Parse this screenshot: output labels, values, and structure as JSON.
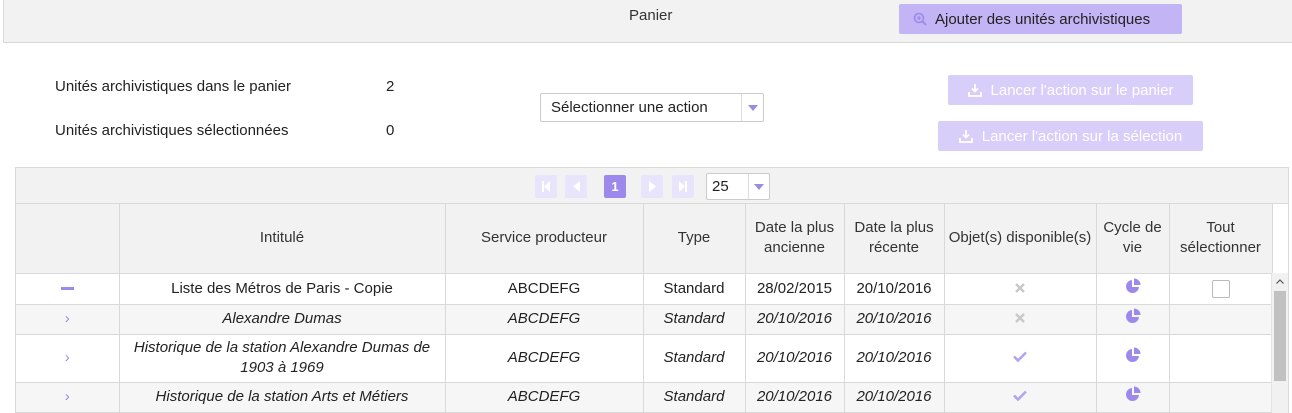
{
  "header": {
    "title": "Panier",
    "add_button": "Ajouter des unités archivistiques",
    "add_icon": "search-plus-icon"
  },
  "stats": {
    "in_cart_label": "Unités archivistiques dans le panier",
    "in_cart_value": "2",
    "selected_label": "Unités archivistiques sélectionnées",
    "selected_value": "0"
  },
  "action_select": {
    "value": "Sélectionner une action"
  },
  "buttons": {
    "run_cart": "Lancer l'action sur le panier",
    "run_selection": "Lancer l'action sur la sélection"
  },
  "pager": {
    "current_page": "1",
    "page_size": "25"
  },
  "colors": {
    "accent": "#9d89ec",
    "button_bg": "#c3b4f5",
    "button_disabled": "#d7cffa"
  },
  "table": {
    "headers": {
      "title": "Intitulé",
      "producer": "Service producteur",
      "type": "Type",
      "date_old": "Date la plus ancienne",
      "date_new": "Date la plus récente",
      "objects": "Objet(s) disponible(s)",
      "lifecycle": "Cycle de vie",
      "select_all": "Tout sélectionner"
    },
    "rows": [
      {
        "title": "Liste des Métros de Paris - Copie",
        "producer": "ABCDEFG",
        "type": "Standard",
        "date_old": "28/02/2015",
        "date_new": "20/10/2016",
        "object_available": false
      },
      {
        "title": "Alexandre Dumas",
        "producer": "ABCDEFG",
        "type": "Standard",
        "date_old": "20/10/2016",
        "date_new": "20/10/2016",
        "object_available": false
      },
      {
        "title": "Historique de la station Alexandre Dumas de 1903 à 1969",
        "producer": "ABCDEFG",
        "type": "Standard",
        "date_old": "20/10/2016",
        "date_new": "20/10/2016",
        "object_available": true
      },
      {
        "title": "Historique de la station Arts et Métiers",
        "producer": "ABCDEFG",
        "type": "Standard",
        "date_old": "20/10/2016",
        "date_new": "20/10/2016",
        "object_available": true
      }
    ]
  }
}
